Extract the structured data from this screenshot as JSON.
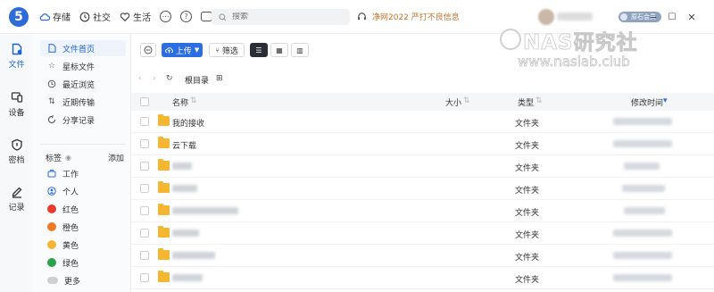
{
  "app": {
    "logo": "5"
  },
  "topnav": {
    "storage": "存储",
    "social": "社交",
    "life": "生活"
  },
  "search": {
    "placeholder": "搜索"
  },
  "notice": "净网2022 严打不良信息",
  "user": {
    "vip_label": "原石会员"
  },
  "window_controls": [
    "−",
    "☐",
    "✕"
  ],
  "rail": {
    "items": [
      {
        "label": "文件",
        "icon": "file-icon",
        "active": true
      },
      {
        "label": "设备",
        "icon": "device-icon",
        "active": false
      },
      {
        "label": "密档",
        "icon": "vault-icon",
        "active": false
      },
      {
        "label": "记录",
        "icon": "record-icon",
        "active": false
      }
    ]
  },
  "sidebar": {
    "items": [
      {
        "label": "文件首页",
        "icon": "document-icon",
        "active": true
      },
      {
        "label": "星标文件",
        "icon": "star-icon",
        "active": false
      },
      {
        "label": "最近浏览",
        "icon": "history-icon",
        "active": false
      },
      {
        "label": "近期传输",
        "icon": "transfer-icon",
        "active": false
      },
      {
        "label": "分享记录",
        "icon": "share-icon",
        "active": false
      }
    ],
    "tags_title": "标签",
    "tags_add": "添加",
    "tags": [
      {
        "label": "工作",
        "icon": "briefcase-icon",
        "color": ""
      },
      {
        "label": "个人",
        "icon": "person-icon",
        "color": ""
      },
      {
        "label": "红色",
        "icon": "dot",
        "color": "#e8392f"
      },
      {
        "label": "橙色",
        "icon": "dot",
        "color": "#f07a23"
      },
      {
        "label": "黄色",
        "icon": "dot",
        "color": "#f5b731"
      },
      {
        "label": "绿色",
        "icon": "dot",
        "color": "#2aa24b"
      },
      {
        "label": "更多",
        "icon": "toggle",
        "color": "#cfcfcf"
      }
    ]
  },
  "toolbar": {
    "upload": "上传",
    "filter": "筛选"
  },
  "path": {
    "root": "根目录"
  },
  "table": {
    "headers": {
      "name": "名称",
      "size": "大小",
      "type": "类型",
      "time": "修改时间"
    },
    "rows": [
      {
        "name": "我的接收",
        "type": "文件夹",
        "blurred": false
      },
      {
        "name": "云下载",
        "type": "文件夹",
        "blurred": false
      },
      {
        "name": "",
        "type": "文件夹",
        "blurred": true
      },
      {
        "name": "",
        "type": "文件夹",
        "blurred": true
      },
      {
        "name": "",
        "type": "文件夹",
        "blurred": true
      },
      {
        "name": "",
        "type": "文件夹",
        "blurred": true
      },
      {
        "name": "",
        "type": "文件夹",
        "blurred": true
      },
      {
        "name": "",
        "type": "文件夹",
        "blurred": true
      }
    ]
  },
  "watermark": {
    "line1": "NAS研究社",
    "line2": "www.naslab.club"
  },
  "colors": {
    "accent": "#2b6de3",
    "notice": "#c8732c",
    "folder": "#f5b731"
  }
}
